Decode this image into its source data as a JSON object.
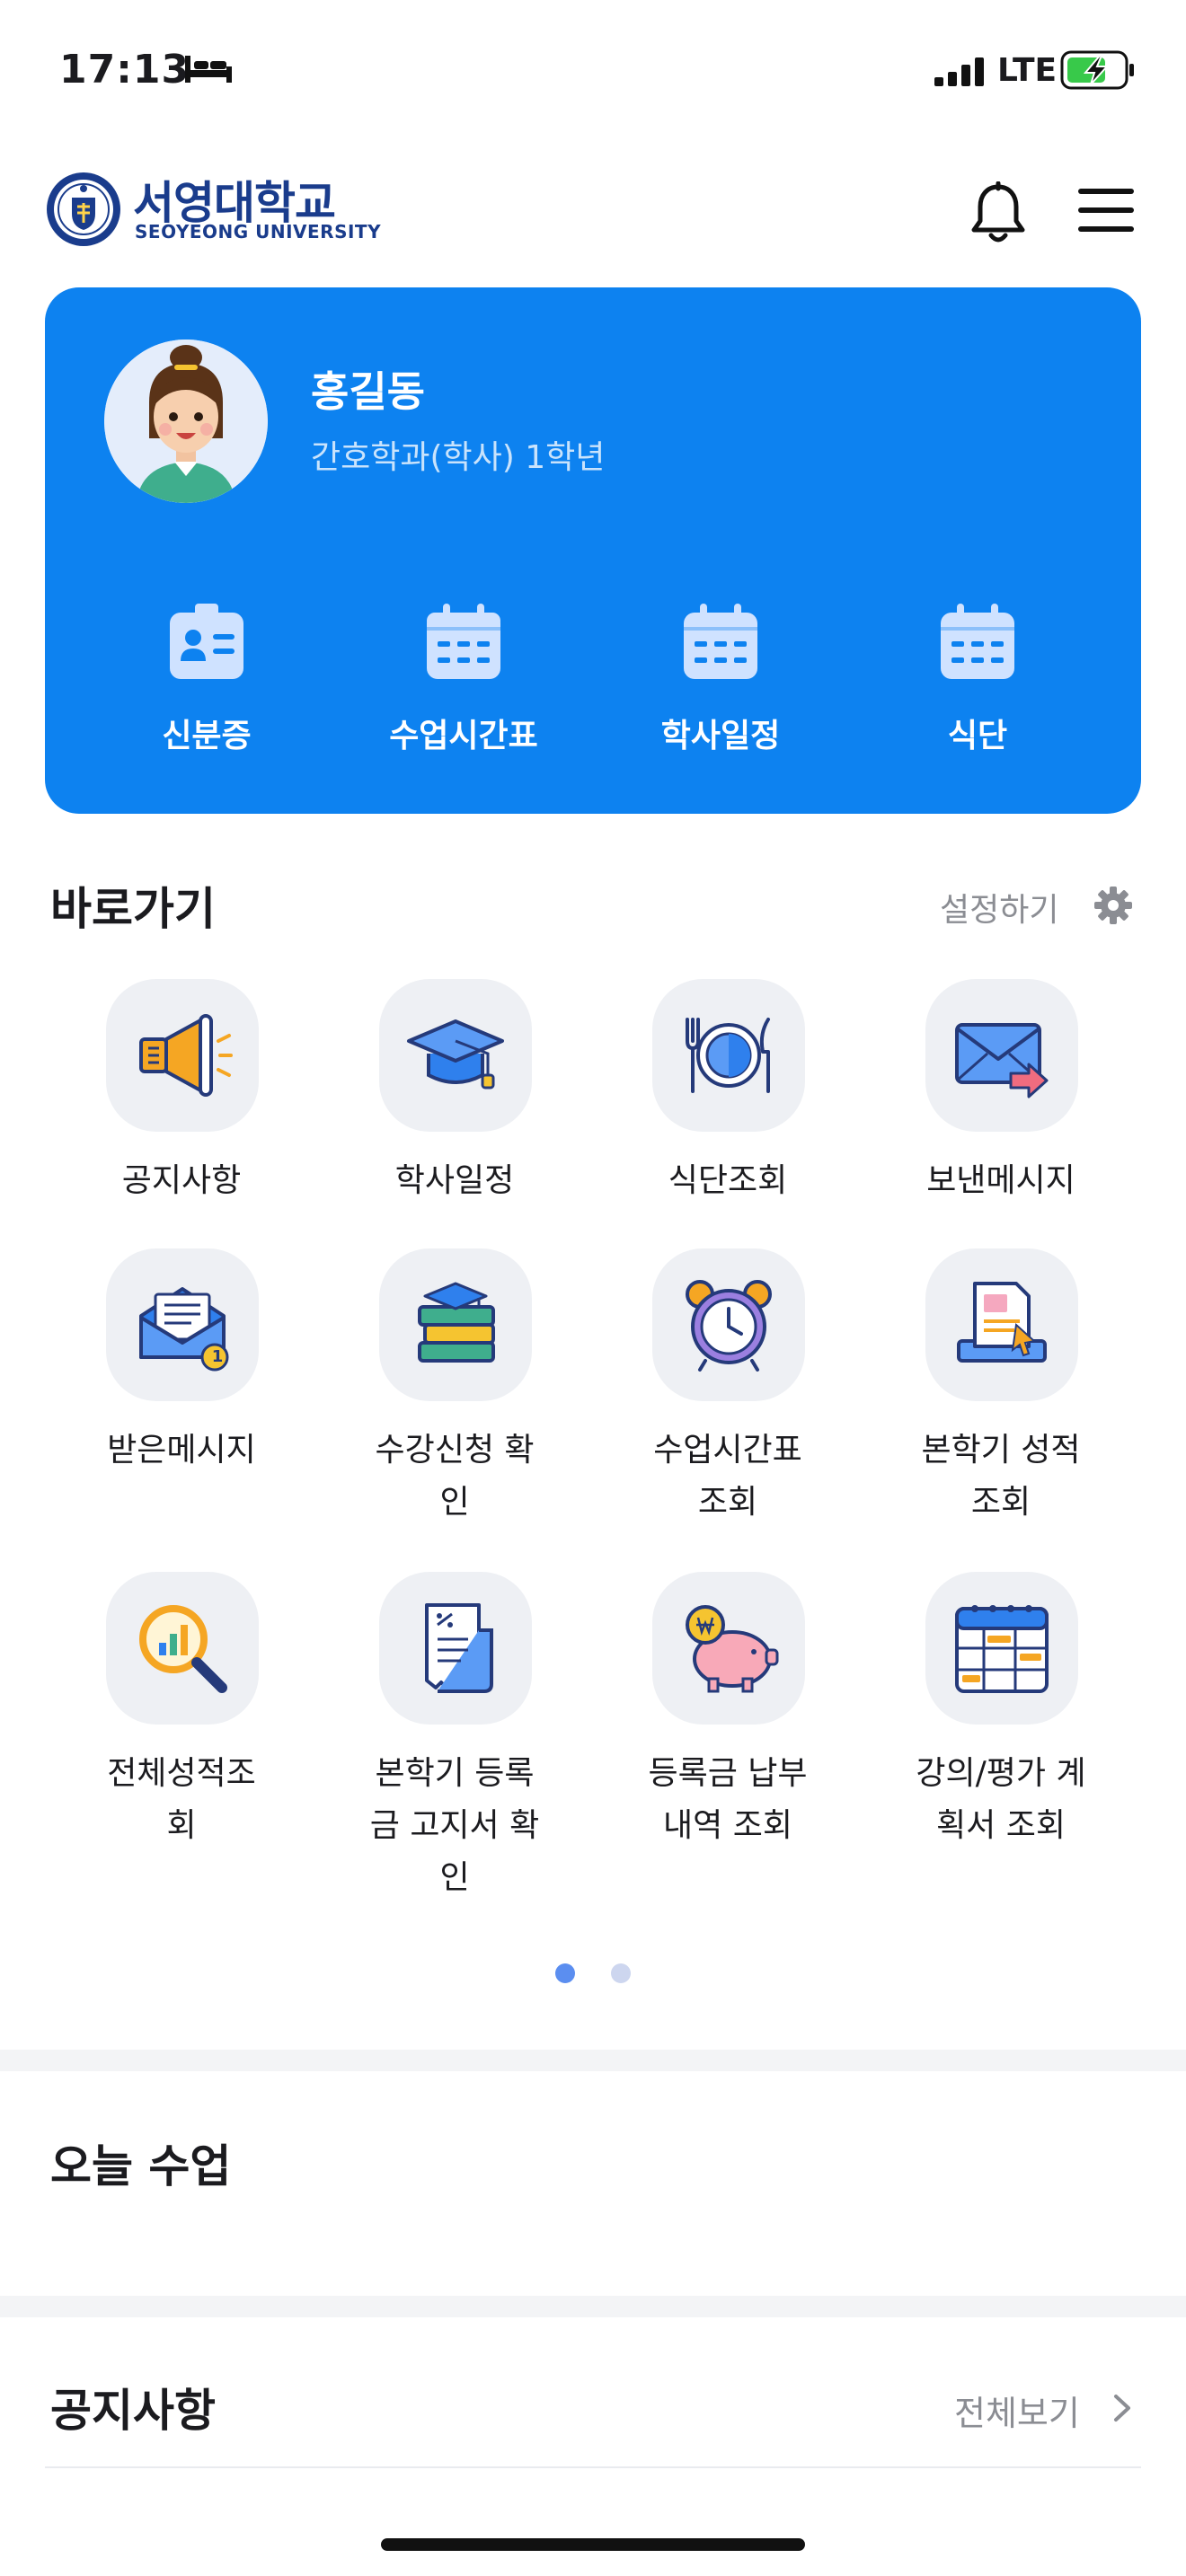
{
  "status_bar": {
    "time": "17:13",
    "network": "LTE",
    "icons": [
      "bed-icon",
      "signal-icon",
      "battery-charging-icon"
    ]
  },
  "header": {
    "logo_kor": "서영대학교",
    "logo_eng": "SEOYEONG UNIVERSITY",
    "icons": [
      "bell-icon",
      "hamburger-menu-icon"
    ]
  },
  "profile": {
    "name": "홍길동",
    "department": "간호학과(학사) 1학년",
    "quick_menu": [
      {
        "label": "신분증",
        "icon": "id-card-icon"
      },
      {
        "label": "수업시간표",
        "icon": "calendar-icon"
      },
      {
        "label": "학사일정",
        "icon": "calendar-icon"
      },
      {
        "label": "식단",
        "icon": "calendar-icon"
      }
    ]
  },
  "shortcuts": {
    "title": "바로가기",
    "settings_label": "설정하기",
    "items": [
      {
        "label": [
          "공지사항"
        ],
        "icon": "megaphone-icon"
      },
      {
        "label": [
          "학사일정"
        ],
        "icon": "graduation-cap-icon"
      },
      {
        "label": [
          "식단조회"
        ],
        "icon": "plate-cutlery-icon"
      },
      {
        "label": [
          "보낸메시지"
        ],
        "icon": "envelope-send-icon"
      },
      {
        "label": [
          "받은메시지"
        ],
        "icon": "envelope-receive-icon"
      },
      {
        "label": [
          "수강신청 확",
          "인"
        ],
        "icon": "books-icon"
      },
      {
        "label": [
          "수업시간표",
          "조회"
        ],
        "icon": "alarm-clock-icon"
      },
      {
        "label": [
          "본학기 성적",
          "조회"
        ],
        "icon": "grade-report-icon"
      },
      {
        "label": [
          "전체성적조",
          "회"
        ],
        "icon": "magnifier-chart-icon"
      },
      {
        "label": [
          "본학기 등록",
          "금 고지서 확",
          "인"
        ],
        "icon": "receipt-icon"
      },
      {
        "label": [
          "등록금 납부",
          "내역 조회"
        ],
        "icon": "piggy-bank-icon"
      },
      {
        "label": [
          "강의/평가 계",
          "획서 조회"
        ],
        "icon": "planner-icon"
      }
    ],
    "badge_count": "1",
    "page_count": 2,
    "current_page": 1
  },
  "today_class": {
    "title": "오늘 수업"
  },
  "notices": {
    "title": "공지사항",
    "view_all_label": "전체보기"
  },
  "colors": {
    "brand_blue": "#0d82f0",
    "logo_navy": "#1a3c8c",
    "tile_bg": "#eef0f4",
    "muted_text": "#8b8d93"
  }
}
